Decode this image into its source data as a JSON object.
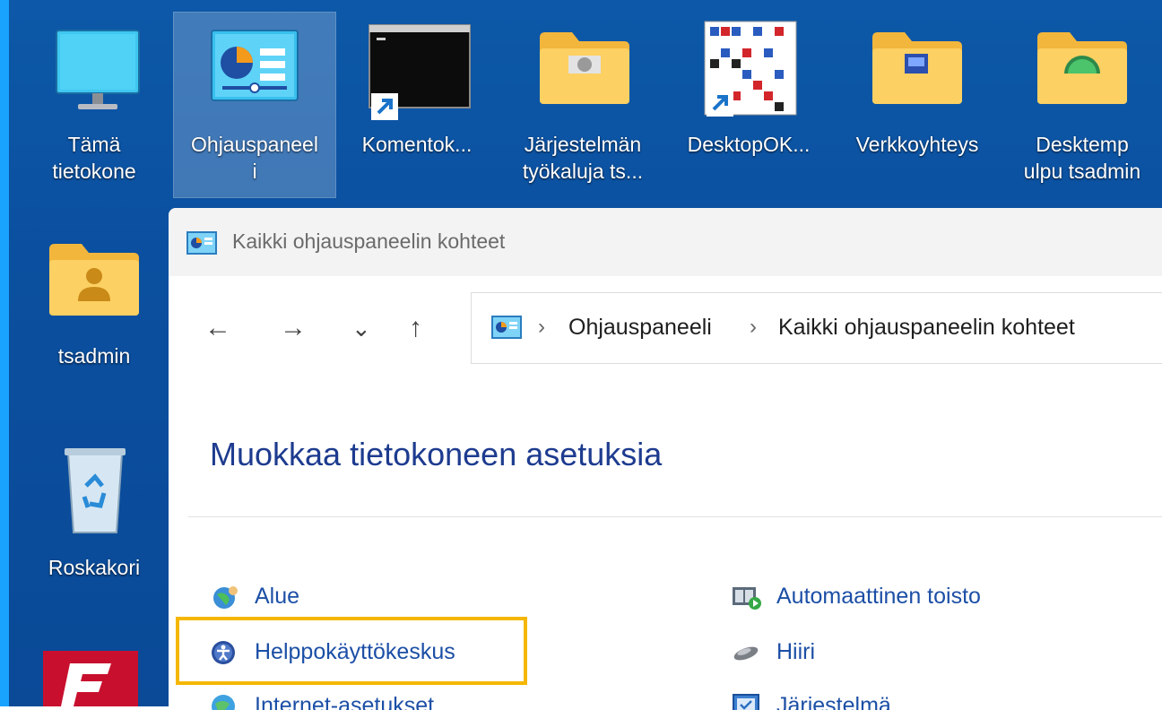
{
  "desktop": {
    "icons": [
      {
        "label1": "Tämä",
        "label2": "tietokone"
      },
      {
        "label1": "Ohjauspaneel",
        "label2": "i"
      },
      {
        "label1": "Komentok...",
        "label2": ""
      },
      {
        "label1": "Järjestelmän",
        "label2": "työkaluja ts..."
      },
      {
        "label1": "DesktopOK...",
        "label2": ""
      },
      {
        "label1": "Verkkoyhteys",
        "label2": ""
      },
      {
        "label1": "Desktemp",
        "label2": "ulpu tsadmin"
      },
      {
        "label1": "tsadmin",
        "label2": ""
      },
      {
        "label1": "Roskakori",
        "label2": ""
      }
    ]
  },
  "window": {
    "title": "Kaikki ohjauspaneelin kohteet",
    "nav": {
      "back": "←",
      "forward": "→",
      "recent": "⌄",
      "up": "↑"
    },
    "address": {
      "sep1": "›",
      "crumb1": "Ohjauspaneeli",
      "sep2": "›",
      "crumb2": "Kaikki ohjauspaneelin kohteet"
    },
    "heading": "Muokkaa tietokoneen asetuksia",
    "items_left": [
      {
        "label": "Alue",
        "icon": "globe-person-icon"
      },
      {
        "label": "Helppokäyttökeskus",
        "icon": "accessibility-icon"
      },
      {
        "label": "Internet-asetukset",
        "icon": "internet-globe-icon"
      }
    ],
    "items_right": [
      {
        "label": "Automaattinen toisto",
        "icon": "autoplay-icon"
      },
      {
        "label": "Hiiri",
        "icon": "mouse-icon"
      },
      {
        "label": "Järjestelmä",
        "icon": "system-icon"
      }
    ]
  },
  "colors": {
    "highlight": "#f5b700",
    "link": "#1c4fa6",
    "heading": "#1d3b8f",
    "desktop": "#0b4f9f"
  }
}
